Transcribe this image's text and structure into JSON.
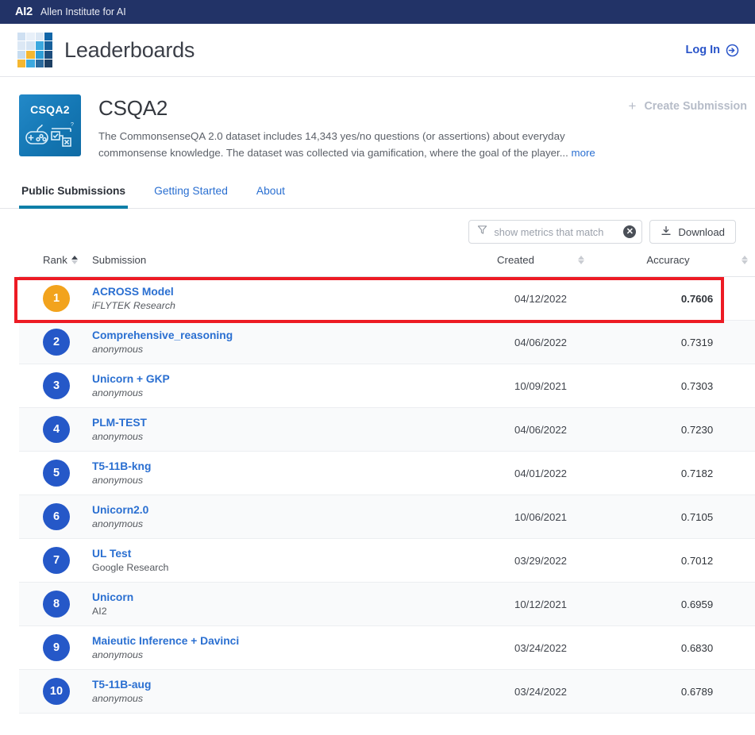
{
  "topbar": {
    "logo": "AI2",
    "org_name": "Allen Institute for AI",
    "bg_color": "#223367"
  },
  "header": {
    "title": "Leaderboards",
    "login_label": "Log In",
    "login_icon": "login-arrow-icon",
    "logo_icon": "ai2-grid-logo-icon"
  },
  "dataset": {
    "icon_label": "CSQA2",
    "icon_graphic": "gamepad-and-checklist-icon",
    "name": "CSQA2",
    "description": "The CommonsenseQA 2.0 dataset includes 14,343 yes/no questions (or assertions) about everyday commonsense knowledge. The dataset was collected via gamification, where the goal of the player...",
    "more_label": "more",
    "create_submission_label": "Create Submission",
    "create_submission_icon": "plus-icon",
    "create_submission_disabled": true
  },
  "tabs": [
    {
      "label": "Public Submissions",
      "active": true
    },
    {
      "label": "Getting Started",
      "active": false
    },
    {
      "label": "About",
      "active": false
    }
  ],
  "toolbar": {
    "filter_icon": "funnel-icon",
    "filter_placeholder": "show metrics that match",
    "filter_value": "",
    "clear_icon": "clear-circle-icon",
    "download_label": "Download",
    "download_icon": "download-icon"
  },
  "table": {
    "columns": [
      {
        "key": "rank",
        "label": "Rank",
        "sortable": true,
        "sort_active": true
      },
      {
        "key": "submission",
        "label": "Submission",
        "sortable": false,
        "sort_active": false
      },
      {
        "key": "created",
        "label": "Created",
        "sortable": true,
        "sort_active": false
      },
      {
        "key": "accuracy",
        "label": "Accuracy",
        "sortable": true,
        "sort_active": false
      }
    ],
    "rows": [
      {
        "rank": "1",
        "badge_color": "gold",
        "name": "ACROSS Model",
        "org": "iFLYTEK Research",
        "org_italic": true,
        "created": "04/12/2022",
        "accuracy": "0.7606",
        "highlighted": true
      },
      {
        "rank": "2",
        "badge_color": "blue",
        "name": "Comprehensive_reasoning",
        "org": "anonymous",
        "org_italic": true,
        "created": "04/06/2022",
        "accuracy": "0.7319",
        "highlighted": false
      },
      {
        "rank": "3",
        "badge_color": "blue",
        "name": "Unicorn + GKP",
        "org": "anonymous",
        "org_italic": true,
        "created": "10/09/2021",
        "accuracy": "0.7303",
        "highlighted": false
      },
      {
        "rank": "4",
        "badge_color": "blue",
        "name": "PLM-TEST",
        "org": "anonymous",
        "org_italic": true,
        "created": "04/06/2022",
        "accuracy": "0.7230",
        "highlighted": false
      },
      {
        "rank": "5",
        "badge_color": "blue",
        "name": "T5-11B-kng",
        "org": "anonymous",
        "org_italic": true,
        "created": "04/01/2022",
        "accuracy": "0.7182",
        "highlighted": false
      },
      {
        "rank": "6",
        "badge_color": "blue",
        "name": "Unicorn2.0",
        "org": "anonymous",
        "org_italic": true,
        "created": "10/06/2021",
        "accuracy": "0.7105",
        "highlighted": false
      },
      {
        "rank": "7",
        "badge_color": "blue",
        "name": "UL Test",
        "org": "Google Research",
        "org_italic": false,
        "created": "03/29/2022",
        "accuracy": "0.7012",
        "highlighted": false
      },
      {
        "rank": "8",
        "badge_color": "blue",
        "name": "Unicorn",
        "org": "AI2",
        "org_italic": false,
        "created": "10/12/2021",
        "accuracy": "0.6959",
        "highlighted": false
      },
      {
        "rank": "9",
        "badge_color": "blue",
        "name": "Maieutic Inference + Davinci",
        "org": "anonymous",
        "org_italic": true,
        "created": "03/24/2022",
        "accuracy": "0.6830",
        "highlighted": false
      },
      {
        "rank": "10",
        "badge_color": "blue",
        "name": "T5-11B-aug",
        "org": "anonymous",
        "org_italic": true,
        "created": "03/24/2022",
        "accuracy": "0.6789",
        "highlighted": false
      }
    ]
  },
  "colors": {
    "navy": "#223367",
    "link_blue": "#2a6fd1",
    "badge_gold": "#f2a31d",
    "badge_blue": "#2558c8",
    "tab_underline": "#0f7fa8",
    "highlight_red": "#ed1b24"
  },
  "logo_grid_colors": [
    "#cfe0f2",
    "#e8f0f9",
    "#dce8f5",
    "#1166a8",
    "#dce8f5",
    "#d5e4f3",
    "#3ba8df",
    "#16609c",
    "#c6dcf0",
    "#f5b731",
    "#2e9ed8",
    "#1d4e7e",
    "#f5b731",
    "#3ba8df",
    "#2a6a9e",
    "#1d3f63"
  ]
}
